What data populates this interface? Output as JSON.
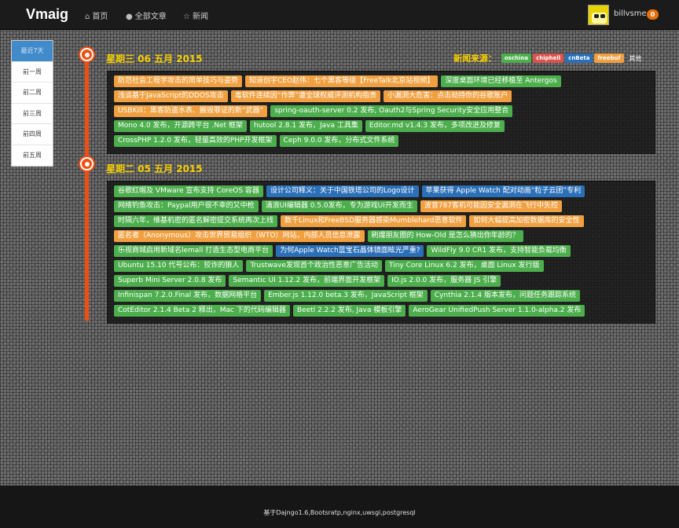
{
  "navbar": {
    "brand": "Vmaig",
    "items": [
      {
        "label": "首页",
        "icon": "home-icon"
      },
      {
        "label": "全部文章",
        "icon": "globe-icon"
      },
      {
        "label": "新闻",
        "icon": "star-icon"
      }
    ],
    "username": "billvsme",
    "notification_count": "0"
  },
  "sidebar": {
    "items": [
      "最近7天",
      "前一周",
      "前二周",
      "前三周",
      "前四周",
      "前五周"
    ],
    "active_index": 0
  },
  "news_sources": {
    "label": "新闻来源：",
    "tags": [
      {
        "label": "oschina",
        "color": "#4cae4c"
      },
      {
        "label": "chiphell",
        "color": "#d9534f"
      },
      {
        "label": "cnBeta",
        "color": "#2a6fb8"
      },
      {
        "label": "freebuf",
        "color": "#f0a040"
      }
    ],
    "other": "其他"
  },
  "days": [
    {
      "title": "星期三 06 五月 2015",
      "news": [
        {
          "text": "防范社会工程学攻击的简单技巧与姿势",
          "source": "orange"
        },
        {
          "text": "知道创宇CEO赵伟：七个黑客等级【FreeTalk北京站视频】",
          "source": "orange"
        },
        {
          "text": "深度桌面环境已经移植至 Antergos",
          "source": "green"
        },
        {
          "text": "浅谈基于JavaScript的DDOS攻击",
          "source": "orange"
        },
        {
          "text": "毒软件连续因“作弊”遭全球权威评测机构指责",
          "source": "orange"
        },
        {
          "text": "小漏洞大危害：点击劫持你的谷歌账户",
          "source": "orange"
        },
        {
          "text": "USBKill：黑客防盗水表、搬毁罪证的新“武器”",
          "source": "orange"
        },
        {
          "text": "spring-oauth-server 0.2 发布, Oauth2与Spring Security安全应用整合",
          "source": "green"
        },
        {
          "text": "Mono 4.0 发布，开源跨平台 .Net 框架",
          "source": "green"
        },
        {
          "text": "hutool 2.8.1 发布，Java 工具集",
          "source": "green"
        },
        {
          "text": "Editor.md v1.4.3 发布，多项改进及修复",
          "source": "green"
        },
        {
          "text": "CrossPHP 1.2.0 发布，轻量高效的PHP开发框架",
          "source": "green"
        },
        {
          "text": "Ceph 9.0.0 发布，分布式文件系统",
          "source": "green"
        }
      ]
    },
    {
      "title": "星期二 05 五月 2015",
      "news": [
        {
          "text": "谷歌红帽及 VMware 宣布支持 CoreOS 容器",
          "source": "green"
        },
        {
          "text": "设计公司释义：关于中国铁塔公司的Logo设计",
          "source": "blue"
        },
        {
          "text": "苹果获得 Apple Watch 配对动画“粒子云团”专利",
          "source": "blue"
        },
        {
          "text": "网络钓鱼攻击：Paypal用户很不幸的又中枪",
          "source": "green"
        },
        {
          "text": "涌浪UI编辑器 0.5.0发布，专为游戏UI开发而生",
          "source": "green"
        },
        {
          "text": "波音787客机可能因安全漏洞在飞行中失控",
          "source": "orange"
        },
        {
          "text": "时隔六年，维基机密的匿名解密提交系统再次上线",
          "source": "green"
        },
        {
          "text": "数千Linux和FreeBSD服务器感染Mumblehard恶意软件",
          "source": "orange"
        },
        {
          "text": "如何大幅提高加密数据库的安全性",
          "source": "orange"
        },
        {
          "text": "匿名者（Anonymous）攻击世界贸易组织（WTO）网站，内部人员信息泄露",
          "source": "orange"
        },
        {
          "text": "刷爆朋友圈的 How-Old 是怎么猜出你年龄的？",
          "source": "green"
        },
        {
          "text": "乐视商城启用新域名lemall 打造生态型电商平台",
          "source": "green"
        },
        {
          "text": "为何Apple Watch蓝宝石晶体镜面眩光严重?",
          "source": "blue"
        },
        {
          "text": "WildFly 9.0 CR1 发布，支持智能负载均衡",
          "source": "green"
        },
        {
          "text": "Ubuntu 15.10 代号公布：狡诈的狼人",
          "source": "green"
        },
        {
          "text": "Trustwave发现首个政治性恶意广告活动",
          "source": "green"
        },
        {
          "text": "Tiny Core Linux 6.2 发布，桌面 Linux 发行版",
          "source": "green"
        },
        {
          "text": "Superb Mini Server 2.0.8 发布",
          "source": "green"
        },
        {
          "text": "Semantic UI 1.12.2 发布，前端界面开发框架",
          "source": "green"
        },
        {
          "text": "IO.js 2.0.0 发布，服务器 JS 引擎",
          "source": "green"
        },
        {
          "text": "Infinispan 7.2.0.Final 发布，数据网格平台",
          "source": "green"
        },
        {
          "text": "Ember.js 1.12.0 beta.3 发布，JavaScript 框架",
          "source": "green"
        },
        {
          "text": "Cynthia 2.1.4 版本发布，问题任务跟踪系统",
          "source": "green"
        },
        {
          "text": "CotEditor 2.1.4 Beta 2 释出，Mac 下的代码编辑器",
          "source": "green"
        },
        {
          "text": "Beetl 2.2.2 发布, Java 模板引擎",
          "source": "green"
        },
        {
          "text": "AeroGear UnifiedPush Server 1.1.0-alpha.2 发布",
          "source": "green"
        }
      ]
    }
  ],
  "footer": {
    "text": "基于Dajngo1.6,Bootsratp,nginx,uwsgi,postgresql"
  }
}
